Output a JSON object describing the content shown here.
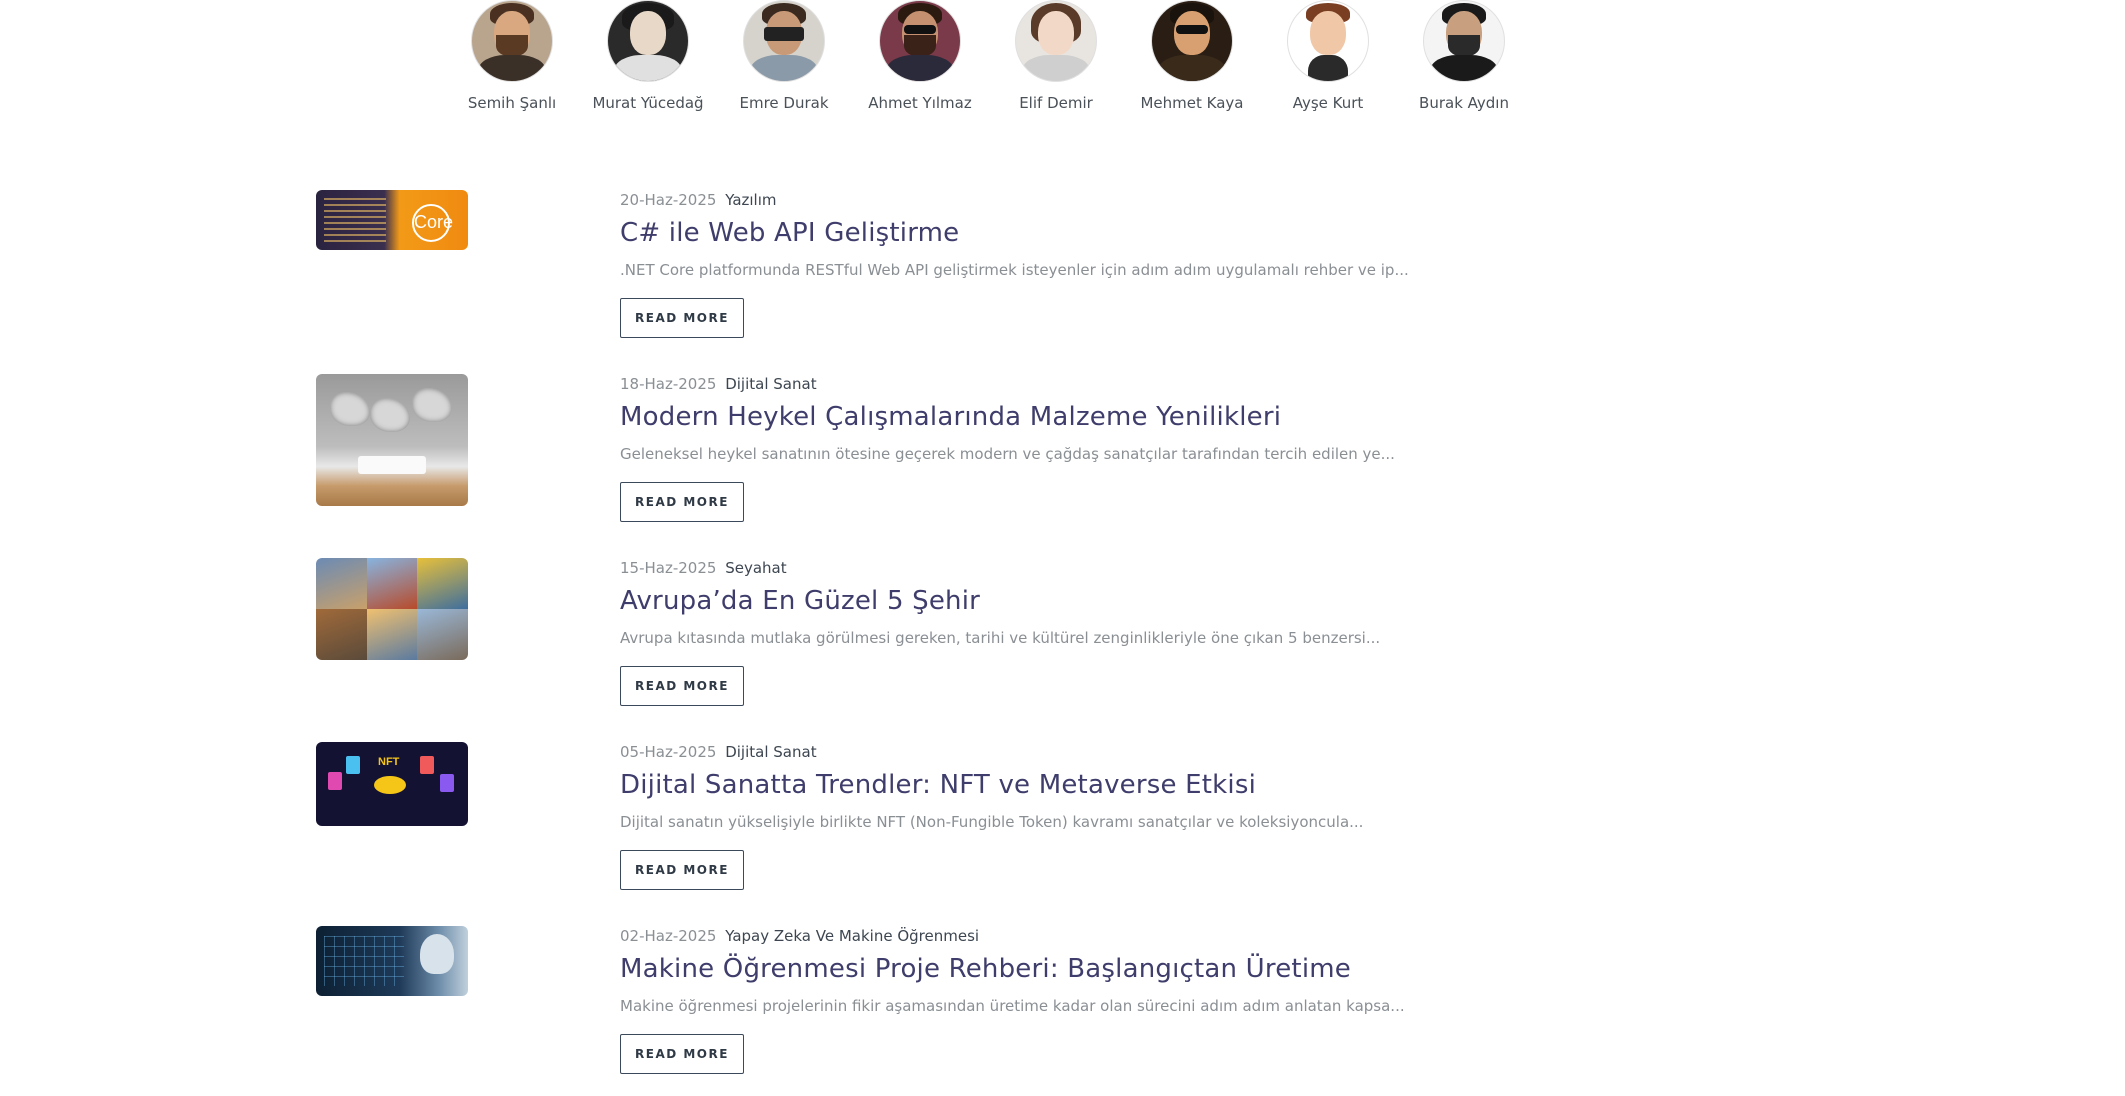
{
  "authors": [
    {
      "name": "Semih Şanlı"
    },
    {
      "name": "Murat Yücedağ"
    },
    {
      "name": "Emre Durak"
    },
    {
      "name": "Ahmet Yılmaz"
    },
    {
      "name": "Elif Demir"
    },
    {
      "name": "Mehmet Kaya"
    },
    {
      "name": "Ayşe Kurt"
    },
    {
      "name": "Burak Aydın"
    }
  ],
  "posts": [
    {
      "date": "20-Haz-2025",
      "category": "Yazılım",
      "title": "C# ile Web API Geliştirme",
      "excerpt": ".NET Core platformunda RESTful Web API geliştirmek isteyenler için adım adım uygulamalı rehber ve ip...",
      "button": "READ MORE",
      "thumb_text": "Core"
    },
    {
      "date": "18-Haz-2025",
      "category": "Dijital Sanat",
      "title": "Modern Heykel Çalışmalarında Malzeme Yenilikleri",
      "excerpt": "Geleneksel heykel sanatının ötesine geçerek modern ve çağdaş sanatçılar tarafından tercih edilen ye...",
      "button": "READ MORE"
    },
    {
      "date": "15-Haz-2025",
      "category": "Seyahat",
      "title": "Avrupa’da En Güzel 5 Şehir",
      "excerpt": "Avrupa kıtasında mutlaka görülmesi gereken, tarihi ve kültürel zenginlikleriyle öne çıkan 5 benzersi...",
      "button": "READ MORE"
    },
    {
      "date": "05-Haz-2025",
      "category": "Dijital Sanat",
      "title": "Dijital Sanatta Trendler: NFT ve Metaverse Etkisi",
      "excerpt": "Dijital sanatın yükselişiyle birlikte NFT (Non-Fungible Token) kavramı sanatçılar ve koleksiyoncula...",
      "button": "READ MORE",
      "thumb_text": "NFT"
    },
    {
      "date": "02-Haz-2025",
      "category": "Yapay Zeka Ve Makine Öğrenmesi",
      "title": "Makine Öğrenmesi Proje Rehberi: Başlangıçtan Üretime",
      "excerpt": "Makine öğrenmesi projelerinin fikir aşamasından üretime kadar olan sürecini adım adım anlatan kapsa...",
      "button": "READ MORE"
    }
  ]
}
